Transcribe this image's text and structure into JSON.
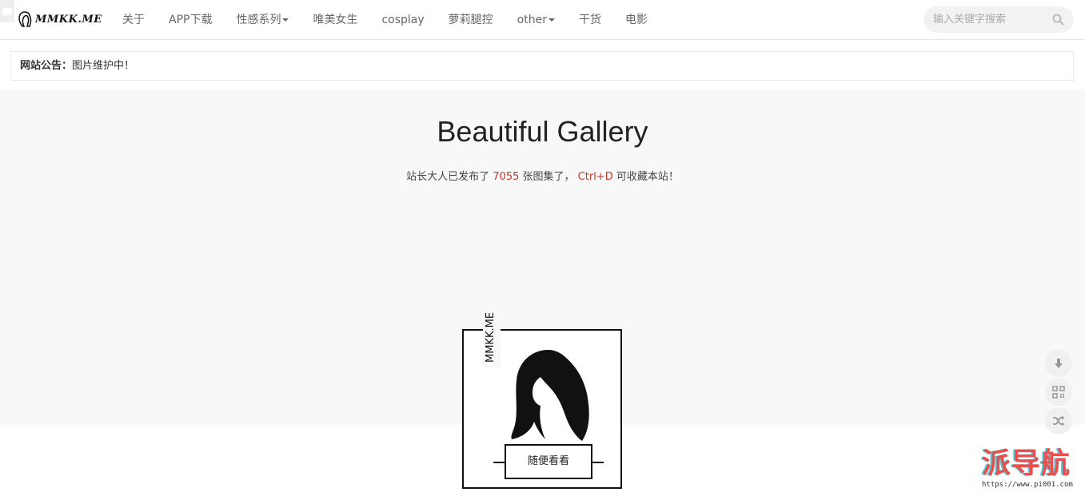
{
  "brand": {
    "logo_text": "MMKK.ME",
    "logo_icon": "woman-silhouette-icon"
  },
  "nav": {
    "items": [
      {
        "label": "关于",
        "has_dropdown": false
      },
      {
        "label": "APP下载",
        "has_dropdown": false
      },
      {
        "label": "性感系列",
        "has_dropdown": true
      },
      {
        "label": "唯美女生",
        "has_dropdown": false
      },
      {
        "label": "cosplay",
        "has_dropdown": false
      },
      {
        "label": "萝莉腿控",
        "has_dropdown": false
      },
      {
        "label": "other",
        "has_dropdown": true
      },
      {
        "label": "干货",
        "has_dropdown": false
      },
      {
        "label": "电影",
        "has_dropdown": false
      }
    ]
  },
  "search": {
    "placeholder": "输入关键字搜索",
    "icon": "search-icon"
  },
  "notice": {
    "label": "网站公告：",
    "text": "图片维护中！"
  },
  "hero": {
    "title": "Beautiful Gallery",
    "sub_before": "站长大人已发布了",
    "count": "7055",
    "sub_middle": "张图集了，",
    "shortcut": "Ctrl+D",
    "sub_after": "可收藏本站！"
  },
  "logo_box": {
    "vertical_text": "MMKK.ME",
    "button_label": "随便看看"
  },
  "side_tools": [
    "arrow-down-icon",
    "qr-code-icon",
    "shuffle-icon"
  ],
  "watermark": {
    "title": "派导航",
    "url": "https://www.pi001.com"
  },
  "colors": {
    "accent_red": "#c0392b",
    "hero_bg": "#f8f8f8",
    "watermark_red": "#e94f4f",
    "watermark_cyan": "#4ec9d9"
  }
}
